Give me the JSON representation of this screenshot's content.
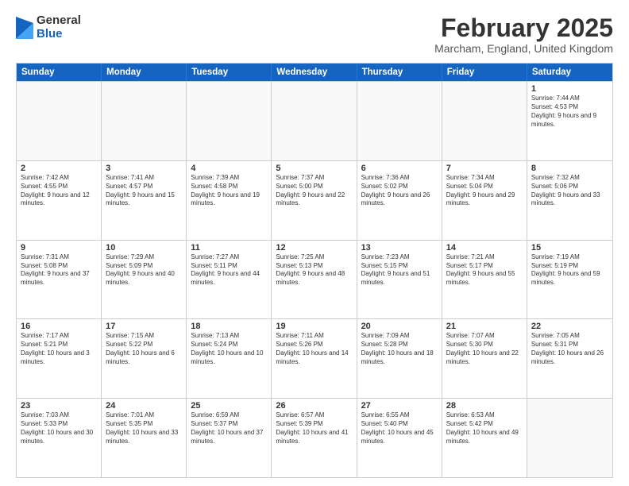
{
  "logo": {
    "general": "General",
    "blue": "Blue"
  },
  "title": "February 2025",
  "subtitle": "Marcham, England, United Kingdom",
  "days": [
    "Sunday",
    "Monday",
    "Tuesday",
    "Wednesday",
    "Thursday",
    "Friday",
    "Saturday"
  ],
  "weeks": [
    [
      {
        "empty": true
      },
      {
        "empty": true
      },
      {
        "empty": true
      },
      {
        "empty": true
      },
      {
        "empty": true
      },
      {
        "empty": true
      },
      {
        "day": "1",
        "sunrise": "7:44 AM",
        "sunset": "4:53 PM",
        "daylight": "9 hours and 9 minutes."
      }
    ],
    [
      {
        "day": "2",
        "sunrise": "7:42 AM",
        "sunset": "4:55 PM",
        "daylight": "9 hours and 12 minutes."
      },
      {
        "day": "3",
        "sunrise": "7:41 AM",
        "sunset": "4:57 PM",
        "daylight": "9 hours and 15 minutes."
      },
      {
        "day": "4",
        "sunrise": "7:39 AM",
        "sunset": "4:58 PM",
        "daylight": "9 hours and 19 minutes."
      },
      {
        "day": "5",
        "sunrise": "7:37 AM",
        "sunset": "5:00 PM",
        "daylight": "9 hours and 22 minutes."
      },
      {
        "day": "6",
        "sunrise": "7:36 AM",
        "sunset": "5:02 PM",
        "daylight": "9 hours and 26 minutes."
      },
      {
        "day": "7",
        "sunrise": "7:34 AM",
        "sunset": "5:04 PM",
        "daylight": "9 hours and 29 minutes."
      },
      {
        "day": "8",
        "sunrise": "7:32 AM",
        "sunset": "5:06 PM",
        "daylight": "9 hours and 33 minutes."
      }
    ],
    [
      {
        "day": "9",
        "sunrise": "7:31 AM",
        "sunset": "5:08 PM",
        "daylight": "9 hours and 37 minutes."
      },
      {
        "day": "10",
        "sunrise": "7:29 AM",
        "sunset": "5:09 PM",
        "daylight": "9 hours and 40 minutes."
      },
      {
        "day": "11",
        "sunrise": "7:27 AM",
        "sunset": "5:11 PM",
        "daylight": "9 hours and 44 minutes."
      },
      {
        "day": "12",
        "sunrise": "7:25 AM",
        "sunset": "5:13 PM",
        "daylight": "9 hours and 48 minutes."
      },
      {
        "day": "13",
        "sunrise": "7:23 AM",
        "sunset": "5:15 PM",
        "daylight": "9 hours and 51 minutes."
      },
      {
        "day": "14",
        "sunrise": "7:21 AM",
        "sunset": "5:17 PM",
        "daylight": "9 hours and 55 minutes."
      },
      {
        "day": "15",
        "sunrise": "7:19 AM",
        "sunset": "5:19 PM",
        "daylight": "9 hours and 59 minutes."
      }
    ],
    [
      {
        "day": "16",
        "sunrise": "7:17 AM",
        "sunset": "5:21 PM",
        "daylight": "10 hours and 3 minutes."
      },
      {
        "day": "17",
        "sunrise": "7:15 AM",
        "sunset": "5:22 PM",
        "daylight": "10 hours and 6 minutes."
      },
      {
        "day": "18",
        "sunrise": "7:13 AM",
        "sunset": "5:24 PM",
        "daylight": "10 hours and 10 minutes."
      },
      {
        "day": "19",
        "sunrise": "7:11 AM",
        "sunset": "5:26 PM",
        "daylight": "10 hours and 14 minutes."
      },
      {
        "day": "20",
        "sunrise": "7:09 AM",
        "sunset": "5:28 PM",
        "daylight": "10 hours and 18 minutes."
      },
      {
        "day": "21",
        "sunrise": "7:07 AM",
        "sunset": "5:30 PM",
        "daylight": "10 hours and 22 minutes."
      },
      {
        "day": "22",
        "sunrise": "7:05 AM",
        "sunset": "5:31 PM",
        "daylight": "10 hours and 26 minutes."
      }
    ],
    [
      {
        "day": "23",
        "sunrise": "7:03 AM",
        "sunset": "5:33 PM",
        "daylight": "10 hours and 30 minutes."
      },
      {
        "day": "24",
        "sunrise": "7:01 AM",
        "sunset": "5:35 PM",
        "daylight": "10 hours and 33 minutes."
      },
      {
        "day": "25",
        "sunrise": "6:59 AM",
        "sunset": "5:37 PM",
        "daylight": "10 hours and 37 minutes."
      },
      {
        "day": "26",
        "sunrise": "6:57 AM",
        "sunset": "5:39 PM",
        "daylight": "10 hours and 41 minutes."
      },
      {
        "day": "27",
        "sunrise": "6:55 AM",
        "sunset": "5:40 PM",
        "daylight": "10 hours and 45 minutes."
      },
      {
        "day": "28",
        "sunrise": "6:53 AM",
        "sunset": "5:42 PM",
        "daylight": "10 hours and 49 minutes."
      },
      {
        "empty": true
      }
    ]
  ]
}
